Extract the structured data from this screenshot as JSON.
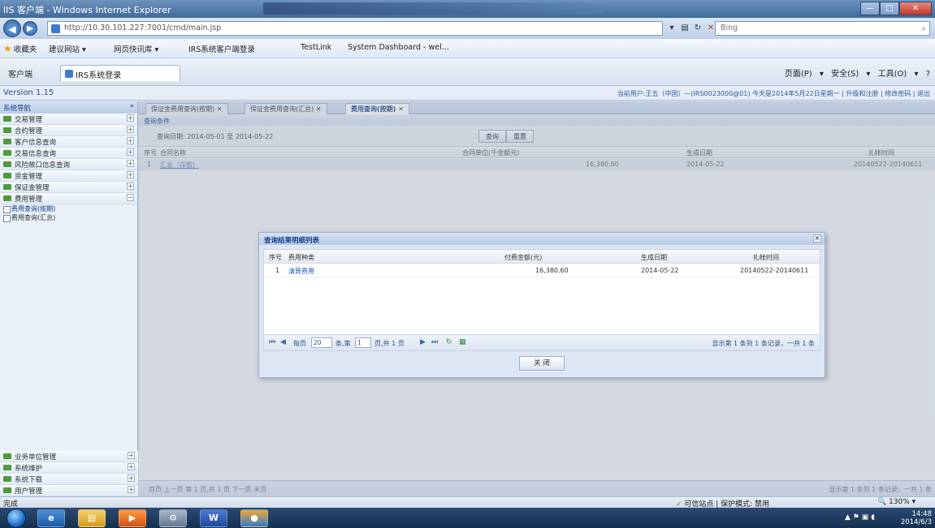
{
  "window": {
    "title": "IIS 客户端 - Windows Internet Explorer",
    "address": "http://10.30.101.227:7001/cmd/main.jsp",
    "address_host": "10.30.101.227",
    "search_placeholder": "Bing",
    "controls": [
      "—",
      "□",
      "✕"
    ]
  },
  "favorites": {
    "label": "收藏夹",
    "items": [
      "建议网站 ▾",
      "网页快讯库 ▾",
      "IRS系统客户端登录",
      "TestLink",
      "System Dashboard - wel..."
    ]
  },
  "tabs": {
    "side_label": "客户端",
    "active_label": "IRS系统登录"
  },
  "commandbar": {
    "items": [
      "页面(P) ▾",
      "安全(S) ▾",
      "工具(O) ▾",
      "?"
    ]
  },
  "page": {
    "version": "Version 1.15",
    "user_info": "当前用户:王五（中国）—(IRS0023000@01) 今天是2014年5月22日星期一 | 升级和注册 | 修改密码 | 退出"
  },
  "sidebar": {
    "header": "系统导航",
    "items": [
      "交易管理",
      "合约管理",
      "客户信息查询",
      "交易信息查询",
      "风险敞口信息查询",
      "资金管理",
      "保证金管理",
      "费用管理"
    ],
    "subitems": [
      "费用查询(按期)",
      "费用查询(汇总)"
    ],
    "bottom_items": [
      "业务单位管理",
      "系统维护",
      "系统下载",
      "用户管理"
    ]
  },
  "main": {
    "tabs": [
      "保证金费用查询(按期) ✕",
      "保证金费用查询(汇总) ✕",
      "费用查询(按期) ✕"
    ],
    "panel_title": "查询条件",
    "query_label": "查询日期: 2014-05-01 至 2014-05-22",
    "buttons": [
      "查询",
      "重置"
    ],
    "columns": [
      "序号",
      "合同名称",
      "合同单位(千金额元)",
      "生成日期",
      "扎帐时间"
    ],
    "row": [
      "1",
      "汇总（存款）",
      "16,380.60",
      "2014-05-22",
      "20140522-20140611"
    ],
    "pager_text": "首页 上一页 第 1 页,共 1 页 下一页 末页",
    "pager_summary": "显示第 1 条到 1 条记录，一共 1 条"
  },
  "modal": {
    "title": "查询结果明细列表",
    "columns": [
      "序号",
      "费用种类",
      "付费金额(元)",
      "生成日期",
      "扎帐时间"
    ],
    "rows": [
      [
        "1",
        "清算费用",
        "16,380.60",
        "2014-05-22",
        "20140522-20140611"
      ]
    ],
    "pager": {
      "page_label": "每页",
      "page_size": "20",
      "unit": "条,第",
      "page_no": "1",
      "of_text": "页,共 1 页",
      "summary": "显示第 1 条到 1 条记录，一共 1 条"
    },
    "close_button": "关 闭"
  },
  "statusbar": {
    "left": "完成",
    "trusted": "可信站点 | 保护模式: 禁用",
    "zoom": "130%"
  },
  "taskbar": {
    "time": "14:48",
    "date": "2014/6/3",
    "word_label": "W"
  }
}
